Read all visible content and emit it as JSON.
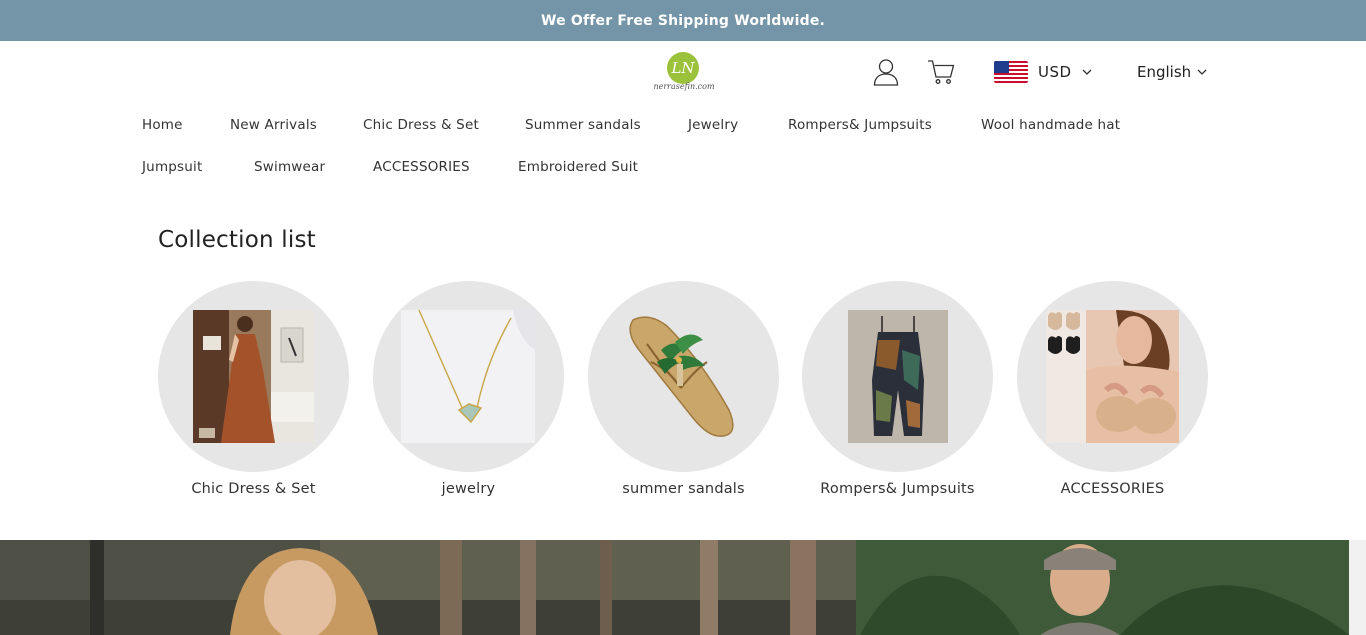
{
  "announcement": "We Offer Free Shipping Worldwide.",
  "logo": {
    "monogram": "LN",
    "text": "nerrasefin.com",
    "color": "#9cc23c"
  },
  "header": {
    "account_icon": "user-icon",
    "cart_icon": "cart-icon",
    "currency": {
      "flag": "us-flag-icon",
      "label": "USD"
    },
    "language": {
      "label": "English"
    }
  },
  "nav": {
    "items": [
      {
        "label": "Home"
      },
      {
        "label": "New Arrivals"
      },
      {
        "label": "Chic Dress & Set"
      },
      {
        "label": "Summer sandals"
      },
      {
        "label": "Jewelry"
      },
      {
        "label": "Rompers& Jumpsuits"
      },
      {
        "label": "Wool handmade hat"
      },
      {
        "label": "Jumpsuit"
      },
      {
        "label": "Swimwear"
      },
      {
        "label": "ACCESSORIES"
      },
      {
        "label": "Embroidered Suit"
      }
    ]
  },
  "collection": {
    "title": "Collection list",
    "items": [
      {
        "label": "Chic Dress & Set"
      },
      {
        "label": "jewelry"
      },
      {
        "label": "summer sandals"
      },
      {
        "label": "Rompers& Jumpsuits"
      },
      {
        "label": "ACCESSORIES"
      }
    ]
  },
  "colors": {
    "announcement_bg": "#7494a8",
    "circle_bg": "#e6e6e6"
  }
}
